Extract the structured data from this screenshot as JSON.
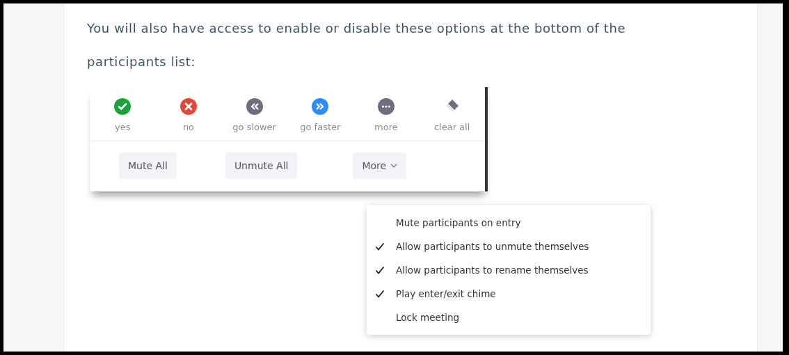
{
  "paragraph": "You will also have access to enable or disable these options at the bottom of the participants list:",
  "reactions": [
    {
      "kind": "yes",
      "label": "yes"
    },
    {
      "kind": "no",
      "label": "no"
    },
    {
      "kind": "slower",
      "label": "go slower"
    },
    {
      "kind": "faster",
      "label": "go faster"
    },
    {
      "kind": "more",
      "label": "more"
    },
    {
      "kind": "clear",
      "label": "clear all"
    }
  ],
  "buttons": [
    {
      "label": "Mute All",
      "dropdown": false
    },
    {
      "label": "Unmute All",
      "dropdown": false
    },
    {
      "label": "More",
      "dropdown": true
    }
  ],
  "menu": [
    {
      "label": "Mute participants on entry",
      "checked": false
    },
    {
      "label": "Allow participants to unmute themselves",
      "checked": true
    },
    {
      "label": "Allow participants to rename themselves",
      "checked": true
    },
    {
      "label": "Play enter/exit chime",
      "checked": true
    },
    {
      "label": "Lock meeting",
      "checked": false
    }
  ]
}
